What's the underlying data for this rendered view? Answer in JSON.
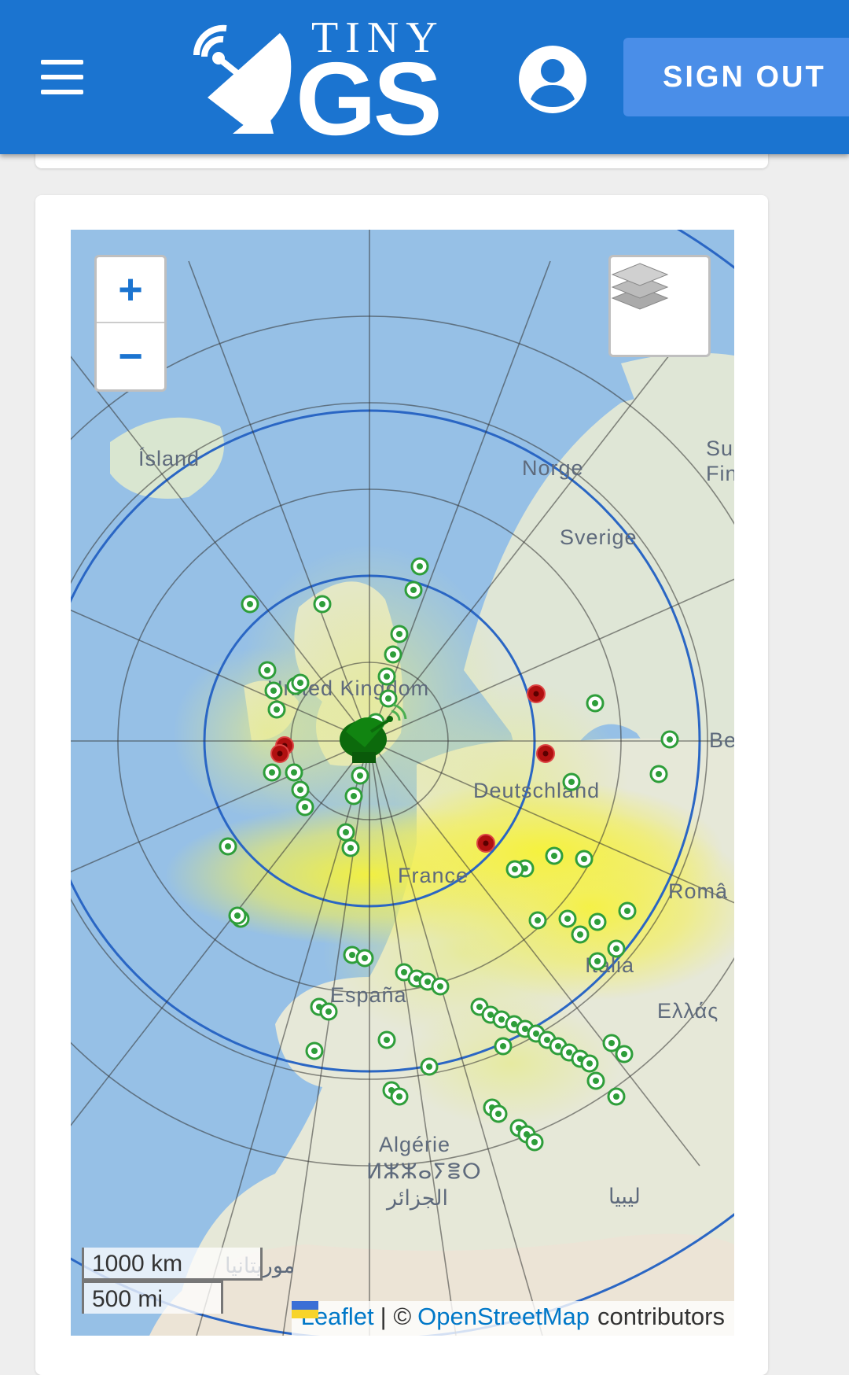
{
  "header": {
    "logo_small": "TINY",
    "logo_big": "GS",
    "signout_label": "SIGN OUT",
    "color": "#1b74d0"
  },
  "map": {
    "zoom_in": "+",
    "zoom_out": "−",
    "labels": {
      "iceland": "Ísland",
      "norway": "Norge",
      "sweden": "Sverige",
      "finland_partial": "Su\nFin",
      "uk": "United Kingdom",
      "germany": "Deutschland",
      "belarus_partial": "Be",
      "france": "France",
      "romania_partial": "Româ",
      "italy": "Italia",
      "spain": "España",
      "greece": "Ελλάς",
      "algeria": "Algérie",
      "algeria_tifinagh": "ⵍⵣⵣⴰⵢⴻⵔ",
      "algeria_arabic": "الجزائر",
      "libya": "ليبيا",
      "mauritania": "موريتانيا"
    },
    "scale": {
      "km": "1000 km",
      "mi": "500 mi"
    },
    "attribution": {
      "leaflet": "Leaflet",
      "separator": "| ©",
      "osm": "OpenStreetMap",
      "suffix": "contributors"
    },
    "station_icon": "satellite-dish-icon",
    "received_marker_color": "#2e9e3a",
    "failed_marker_color": "#b01010"
  }
}
